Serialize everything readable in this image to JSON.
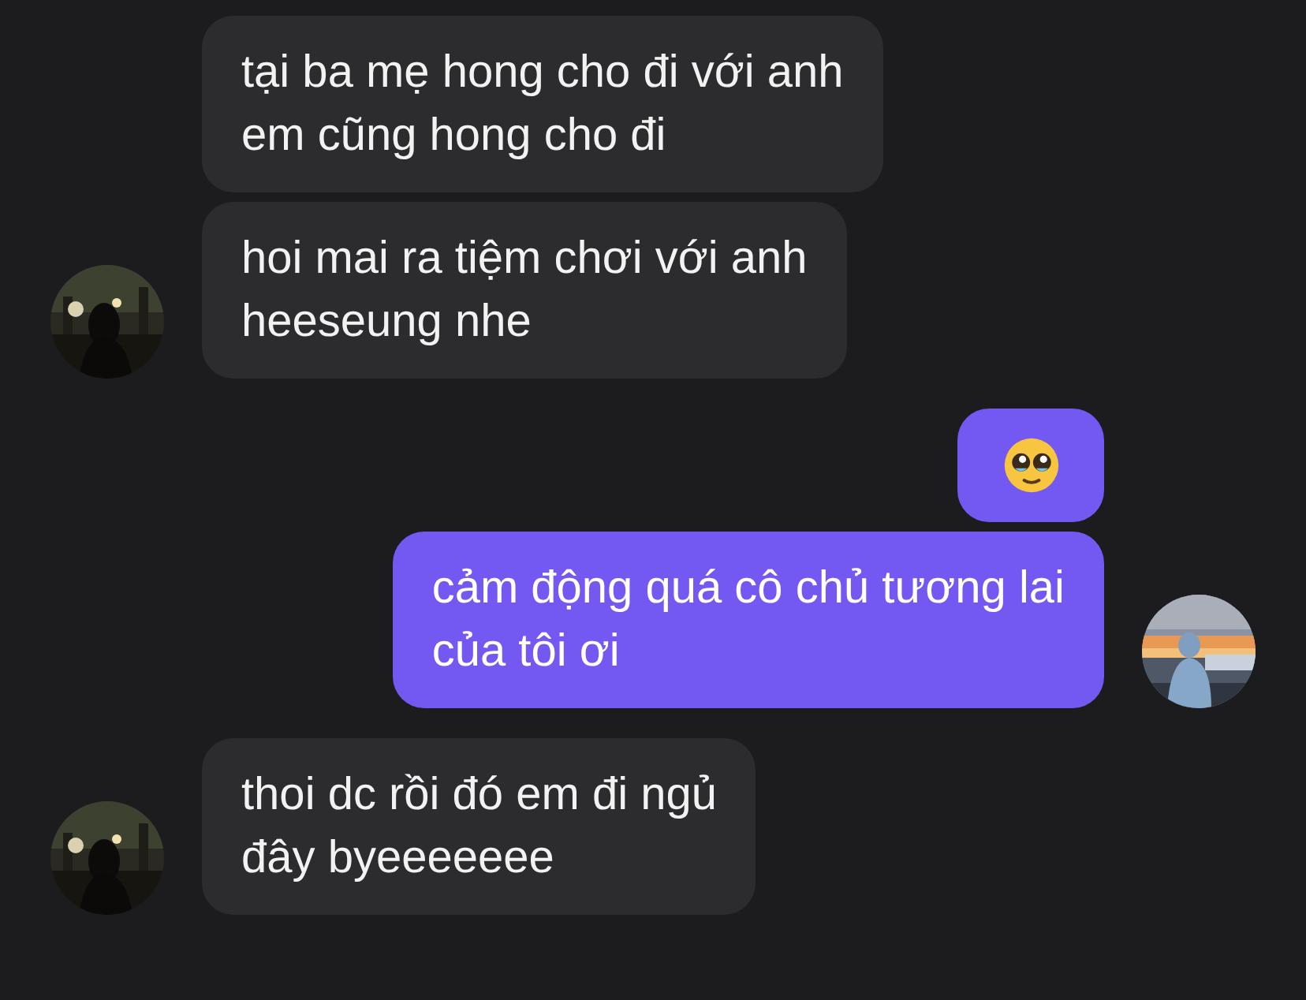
{
  "messages": [
    {
      "outgoing": false,
      "kind": "text",
      "avatar": false,
      "text": "tại ba mẹ hong cho đi với anh\nem cũng hong cho đi"
    },
    {
      "outgoing": false,
      "kind": "text",
      "avatar": true,
      "text": "hoi mai ra tiệm chơi với anh\nheeseung nhe"
    },
    {
      "outgoing": true,
      "kind": "emoji",
      "avatar": false
    },
    {
      "outgoing": true,
      "kind": "text",
      "avatar": true,
      "text": "cảm động quá cô chủ tương lai\ncủa tôi ơi"
    },
    {
      "outgoing": false,
      "kind": "text",
      "avatar": true,
      "text": "thoi dc rồi đó em đi ngủ\nđây byeeeeeee"
    }
  ]
}
